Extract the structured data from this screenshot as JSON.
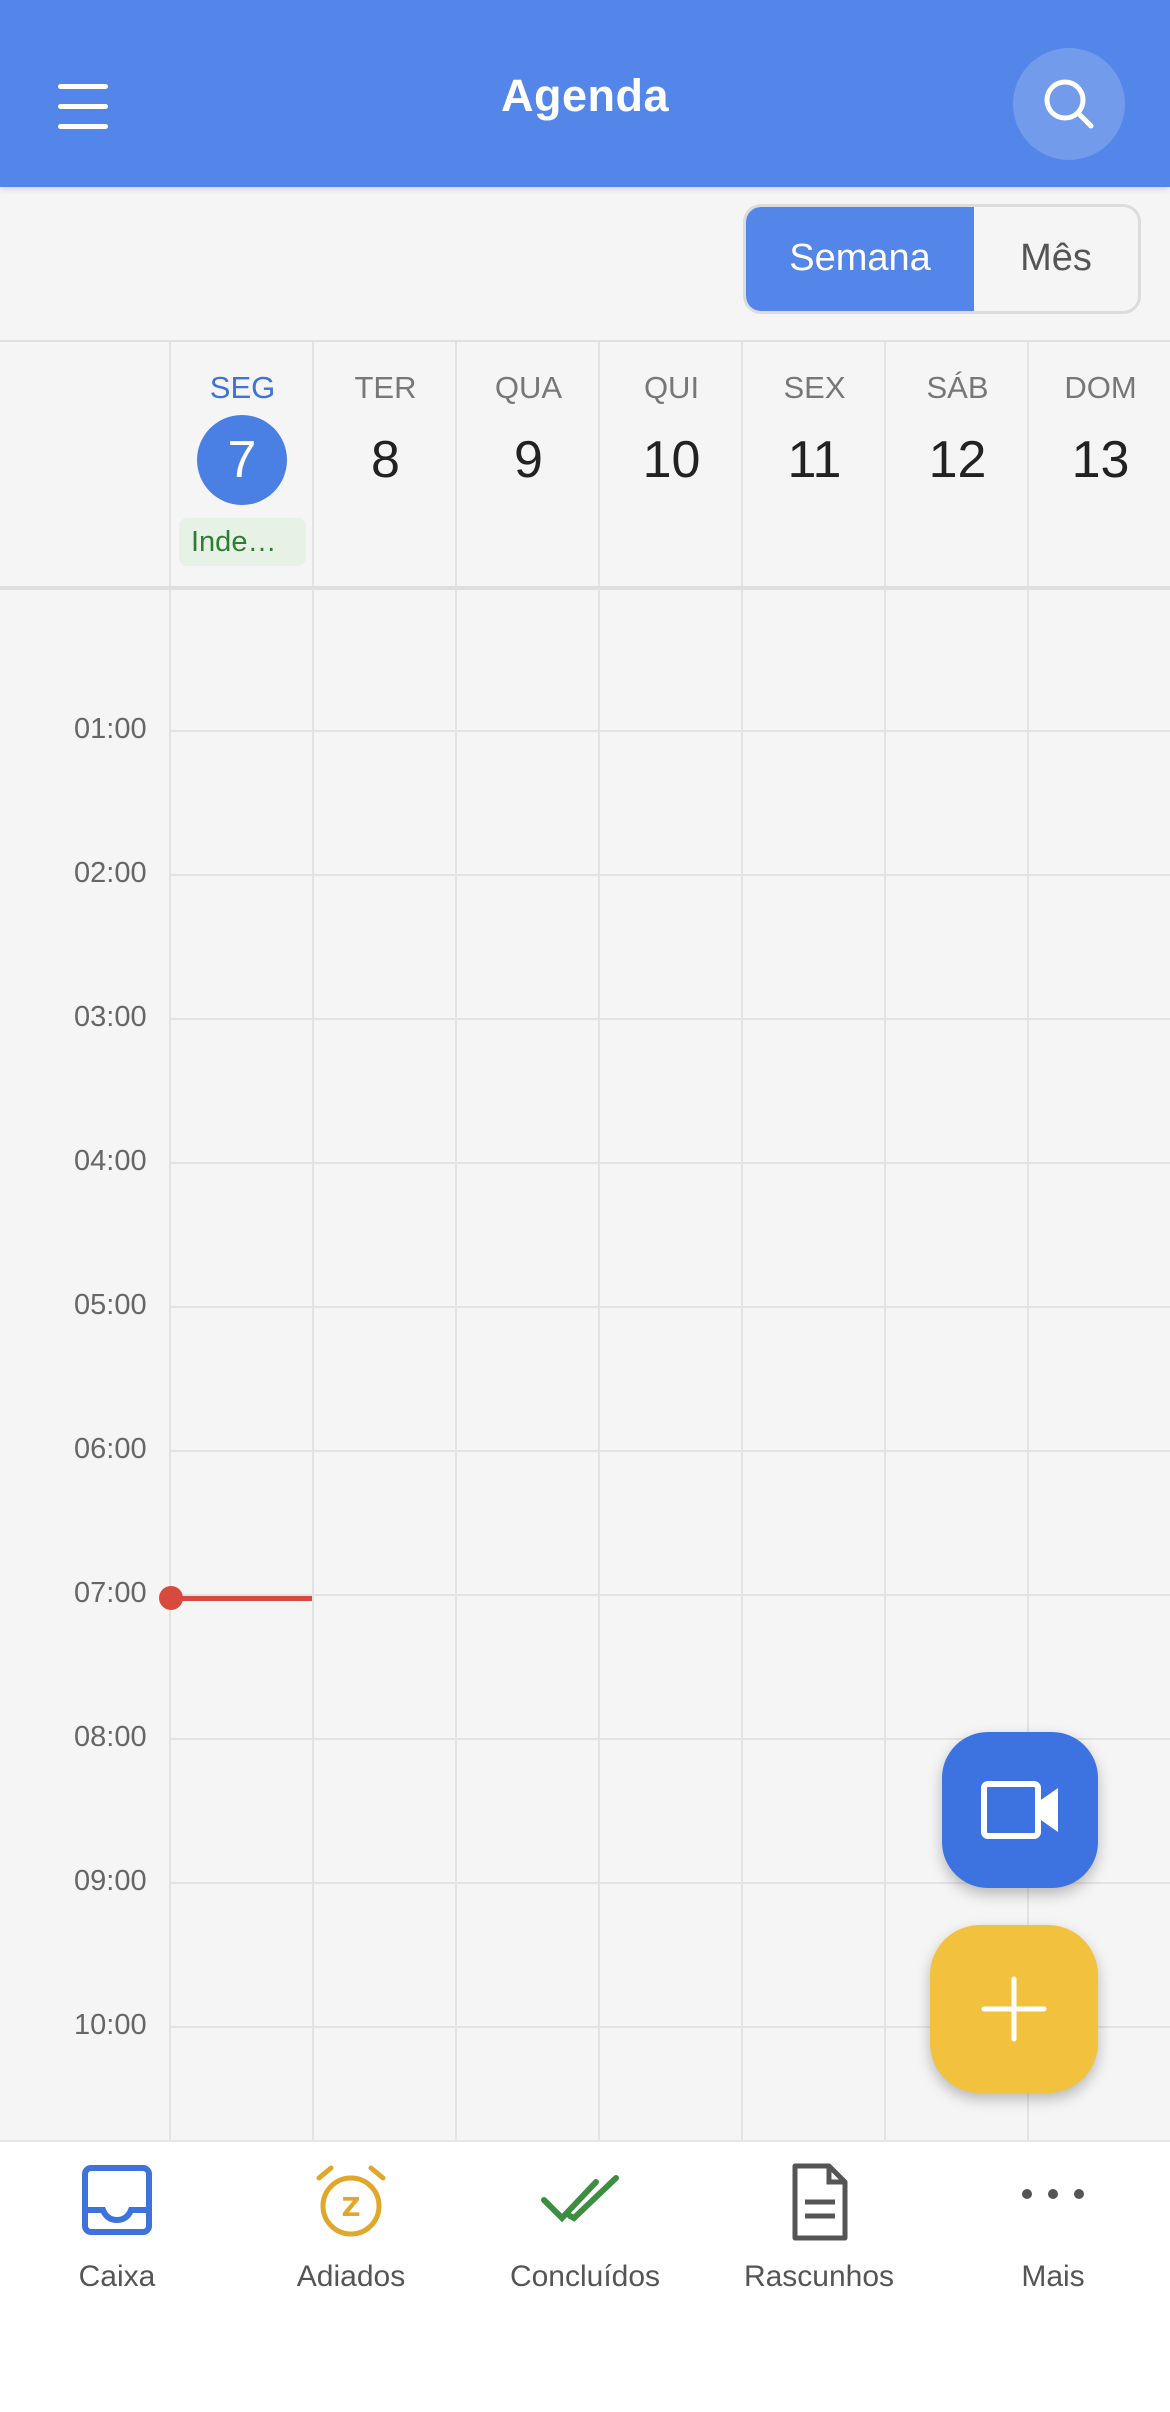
{
  "header": {
    "title": "Agenda",
    "menu_icon": "menu-icon",
    "search_icon": "search-icon",
    "color": "#5386e8"
  },
  "view_toggle": {
    "week_label": "Semana",
    "month_label": "Mês",
    "selected": "Semana"
  },
  "days": [
    {
      "name": "SEG",
      "number": "7",
      "today": true,
      "event": "Inde…"
    },
    {
      "name": "TER",
      "number": "8"
    },
    {
      "name": "QUA",
      "number": "9"
    },
    {
      "name": "QUI",
      "number": "10"
    },
    {
      "name": "SEX",
      "number": "11"
    },
    {
      "name": "SÁB",
      "number": "12"
    },
    {
      "name": "DOM",
      "number": "13"
    }
  ],
  "time_labels": [
    "01:00",
    "02:00",
    "03:00",
    "04:00",
    "05:00",
    "06:00",
    "07:00",
    "08:00",
    "09:00",
    "10:00"
  ],
  "current_time_indicator": {
    "time": "07:00",
    "color": "#d84a3e"
  },
  "fab": {
    "video_icon": "video-camera-icon",
    "add_icon": "plus-icon",
    "add_color": "#f2c23e",
    "video_color": "#3d73e0"
  },
  "bottom_nav": [
    {
      "label": "Caixa",
      "icon": "inbox-icon"
    },
    {
      "label": "Adiados",
      "icon": "snooze-alarm-icon"
    },
    {
      "label": "Concluídos",
      "icon": "double-check-icon"
    },
    {
      "label": "Rascunhos",
      "icon": "document-icon"
    },
    {
      "label": "Mais",
      "icon": "more-horizontal-icon"
    }
  ]
}
